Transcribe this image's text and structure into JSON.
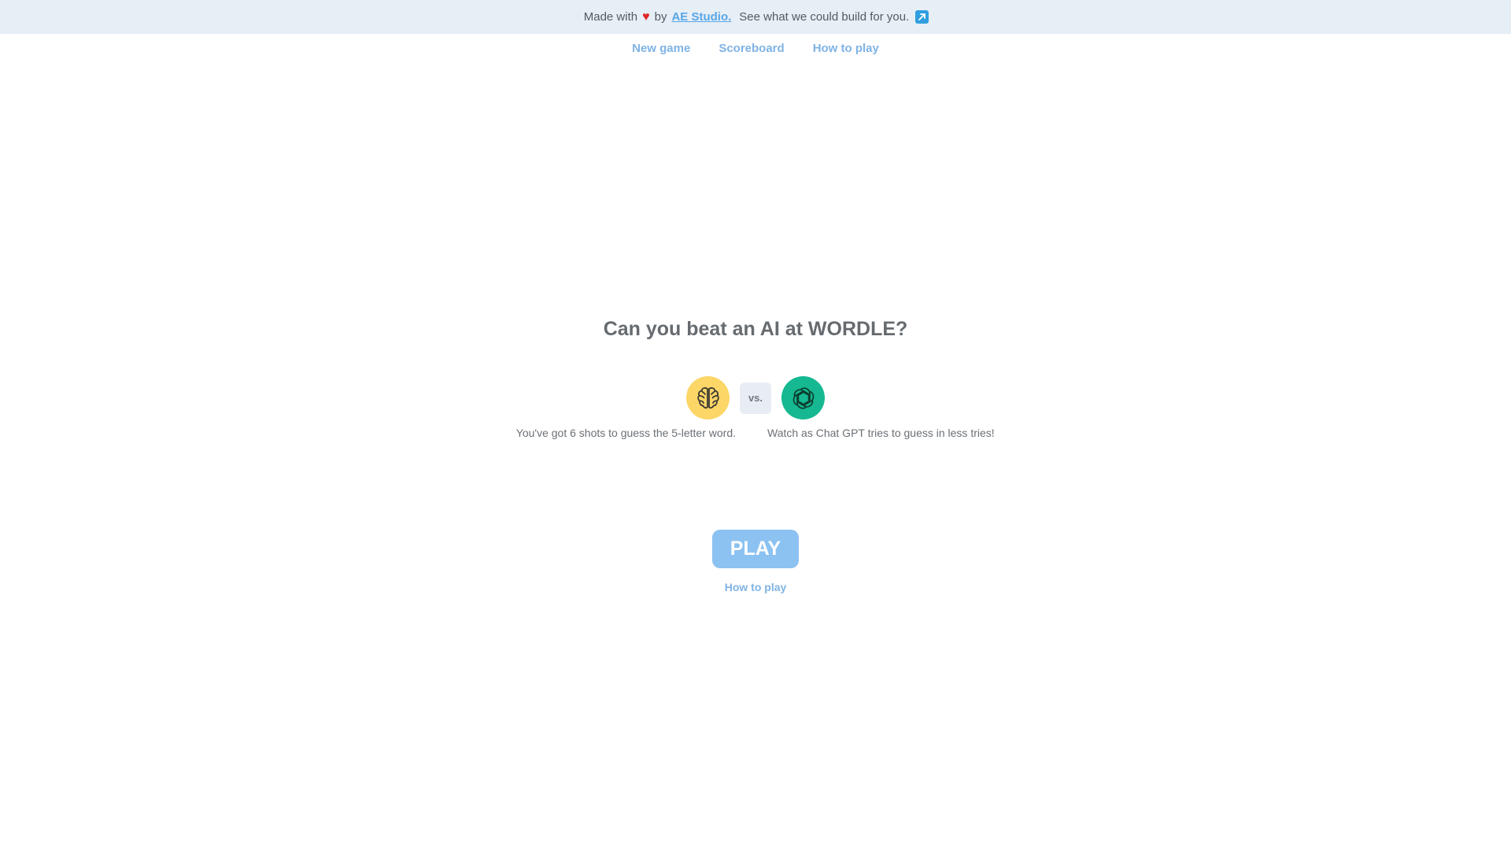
{
  "banner": {
    "made_with": "Made with",
    "heart": "♥",
    "by": "by",
    "brand_link": "AE Studio.",
    "cta": "See what we could build for you.",
    "arrow_icon": "external-arrow-icon",
    "arrow_color": "#2f9fe0"
  },
  "nav": {
    "items": [
      "New game",
      "Scoreboard",
      "How to play"
    ]
  },
  "main": {
    "title": "Can you beat an AI at WORDLE?",
    "vs_label": "vs.",
    "player_caption": "You've got 6 shots to guess the 5-letter word.",
    "ai_caption": "Watch as Chat GPT tries to guess in less tries!",
    "player_icon": "brain-icon",
    "ai_icon": "openai-logo-icon",
    "play_label": "PLAY",
    "how_to_play_link": "How to play"
  },
  "colors": {
    "banner_bg": "#e6eef6",
    "link": "#7fb3e6",
    "play_button": "#8cc2f1",
    "brain_bg": "#fcd667",
    "gpt_bg": "#15b891"
  }
}
